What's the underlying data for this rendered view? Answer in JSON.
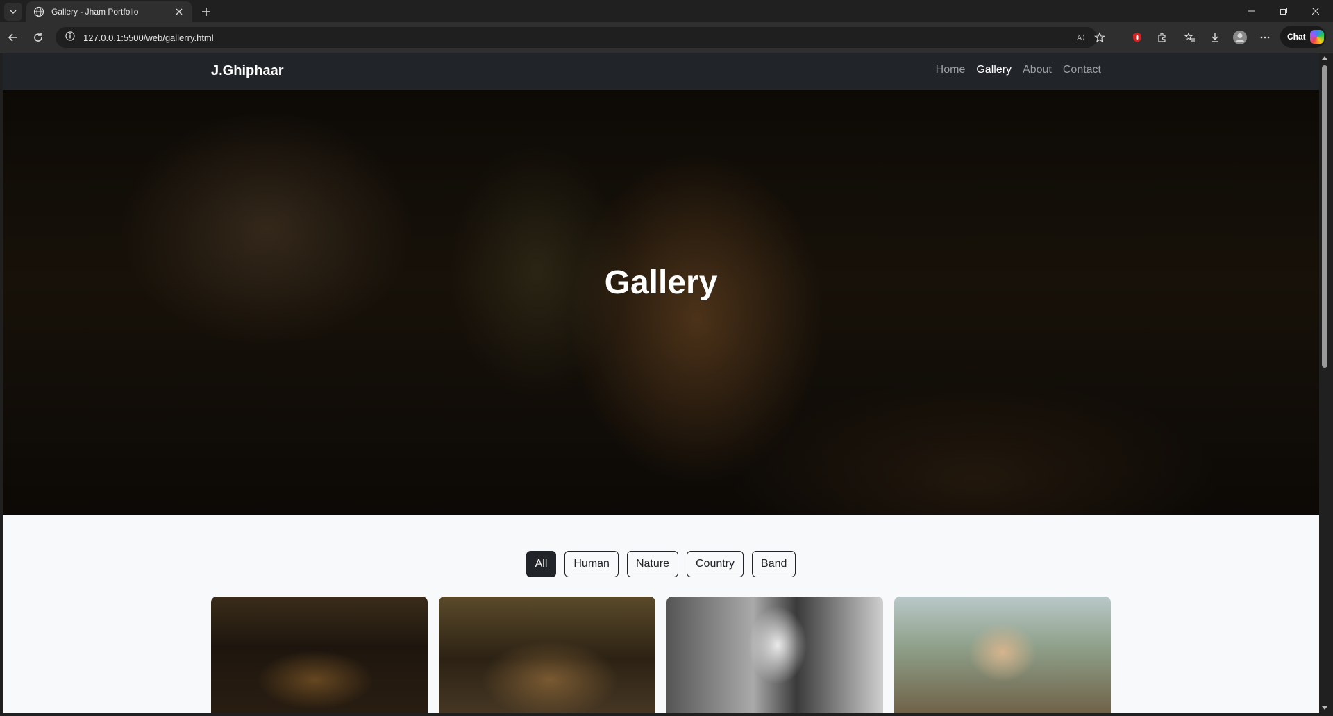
{
  "browser": {
    "tab_title": "Gallery - Jham Portfolio",
    "url": "127.0.0.1:5500/web/gallerry.html",
    "chat_label": "Chat"
  },
  "site": {
    "brand": "J.Ghiphaar",
    "nav": [
      {
        "label": "Home",
        "active": false
      },
      {
        "label": "Gallery",
        "active": true
      },
      {
        "label": "About",
        "active": false
      },
      {
        "label": "Contact",
        "active": false
      }
    ]
  },
  "hero": {
    "title": "Gallery"
  },
  "filters": [
    {
      "label": "All",
      "active": true
    },
    {
      "label": "Human",
      "active": false
    },
    {
      "label": "Nature",
      "active": false
    },
    {
      "label": "Country",
      "active": false
    },
    {
      "label": "Band",
      "active": false
    }
  ],
  "colors": {
    "navbar": "#212529",
    "page_bg": "#f8f9fa",
    "active_filter": "#212529"
  }
}
